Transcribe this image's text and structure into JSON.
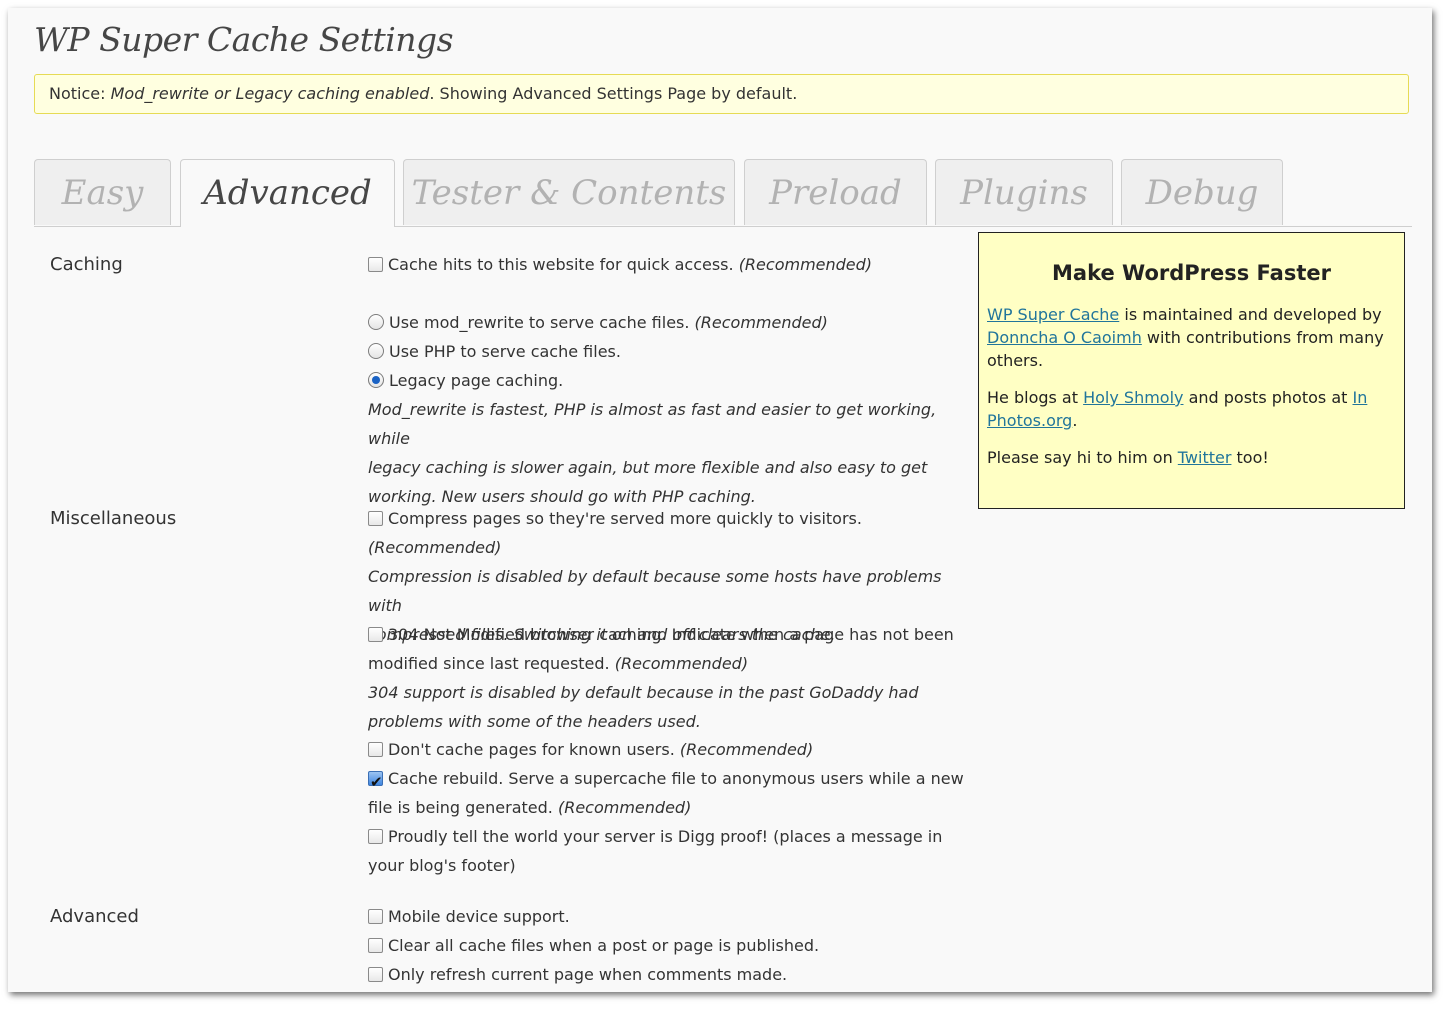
{
  "page": {
    "title": "WP Super Cache Settings",
    "notice_prefix": "Notice: ",
    "notice_em": "Mod_rewrite or Legacy caching enabled",
    "notice_rest": ". Showing Advanced Settings Page by default."
  },
  "tabs": [
    {
      "label": "Easy"
    },
    {
      "label": "Advanced",
      "active": true
    },
    {
      "label": "Tester & Contents"
    },
    {
      "label": "Preload"
    },
    {
      "label": "Plugins"
    },
    {
      "label": "Debug"
    }
  ],
  "sections": {
    "caching": "Caching",
    "misc": "Miscellaneous",
    "advanced": "Advanced"
  },
  "caching": {
    "cache_hits": {
      "text": "Cache hits to this website for quick access. ",
      "rec": "(Recommended)",
      "checked": false
    },
    "mod_rewrite": {
      "text": "Use mod_rewrite to serve cache files. ",
      "rec": "(Recommended)",
      "selected": false
    },
    "php": {
      "text": "Use PHP to serve cache files.",
      "selected": false
    },
    "legacy": {
      "text": "Legacy page caching.",
      "selected": true
    },
    "desc1": "Mod_rewrite is fastest, PHP is almost as fast and easier to get working, while",
    "desc2": "legacy caching is slower again, but more flexible and also easy to get",
    "desc3": "working. New users should go with PHP caching."
  },
  "misc": {
    "compress": {
      "text": "Compress pages so they're served more quickly to visitors.",
      "rec": "(Recommended)",
      "checked": false
    },
    "compress_desc1": "Compression is disabled by default because some hosts have problems with",
    "compress_desc2": "compressed files. Switching it on and off clears the cache.",
    "not_modified": {
      "text": "304 Not Modified browser caching. Indicate when a page has not been",
      "text2": "modified since last requested. ",
      "rec": "(Recommended)",
      "checked": false
    },
    "nm_desc1": "304 support is disabled by default because in the past GoDaddy had",
    "nm_desc2": "problems with some of the headers used.",
    "known_users": {
      "text": "Don't cache pages for known users. ",
      "rec": "(Recommended)",
      "checked": false
    },
    "rebuild": {
      "text": "Cache rebuild. Serve a supercache file to anonymous users while a new",
      "text2": "file is being generated. ",
      "rec": "(Recommended)",
      "checked": true
    },
    "digg": {
      "text": "Proudly tell the world your server is Digg proof! (places a message in",
      "text2": "your blog's footer)",
      "checked": false
    }
  },
  "advanced": {
    "mobile": {
      "text": "Mobile device support.",
      "checked": false
    },
    "clear_all": {
      "text": "Clear all cache files when a post or page is published.",
      "checked": false
    },
    "refresh": {
      "text": "Only refresh current page when comments made.",
      "checked": false
    }
  },
  "sidebox": {
    "heading": "Make WordPress Faster",
    "p1_link1": "WP Super Cache",
    "p1_t1": " is maintained and developed by ",
    "p1_link2": "Donncha O Caoimh",
    "p1_t2": " with contributions from many others.",
    "p2_t1": "He blogs at ",
    "p2_link1": "Holy Shmoly",
    "p2_t2": " and posts photos at ",
    "p2_link2": "In Photos.org",
    "p2_t3": ".",
    "p3_t1": "Please say hi to him on ",
    "p3_link": "Twitter",
    "p3_t2": " too!"
  }
}
